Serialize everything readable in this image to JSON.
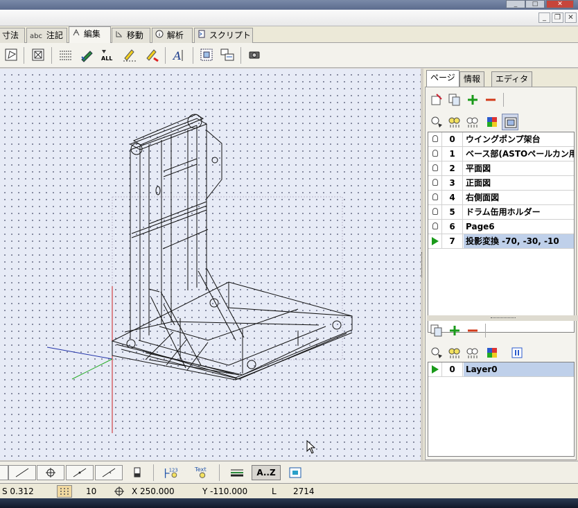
{
  "tabs": [
    {
      "label": "寸法",
      "icon": "dimension-icon",
      "active": false
    },
    {
      "label": "注記",
      "icon": "abc-text-icon",
      "icon_text": "abc",
      "active": false
    },
    {
      "label": "編集",
      "icon": "edit-icon",
      "active": true
    },
    {
      "label": "移動",
      "icon": "move-icon",
      "active": false
    },
    {
      "label": "解析",
      "icon": "info-icon",
      "active": false
    },
    {
      "label": "スクリプト",
      "icon": "script-icon",
      "active": false
    }
  ],
  "right_panel": {
    "tabs": [
      {
        "label": "ページ",
        "active": true
      },
      {
        "label": "情報",
        "active": false
      },
      {
        "label": "エディタ",
        "active": false
      }
    ],
    "pages": [
      {
        "index": "0",
        "name": "ウイングポンプ架台",
        "state": "visible"
      },
      {
        "index": "1",
        "name": "ベース部(ASTOペールカン用",
        "state": "visible"
      },
      {
        "index": "2",
        "name": "平面図",
        "state": "visible"
      },
      {
        "index": "3",
        "name": "正面図",
        "state": "visible"
      },
      {
        "index": "4",
        "name": "右側面図",
        "state": "visible"
      },
      {
        "index": "5",
        "name": "ドラム缶用ホルダー",
        "state": "visible"
      },
      {
        "index": "6",
        "name": "Page6",
        "state": "visible"
      },
      {
        "index": "7",
        "name": "投影変換 -70, -30, -10",
        "state": "current"
      }
    ],
    "layers": [
      {
        "index": "0",
        "name": "Layer0",
        "state": "current"
      }
    ]
  },
  "bottom_toolbar": {
    "text_tool_label": "Text",
    "numbering_tool_label": "123",
    "sort_button_label": "A..Z"
  },
  "status": {
    "scale": "S 0.312",
    "grid": "10",
    "x": "X 250.000",
    "y": "Y -110.000",
    "l_label": "L",
    "l_value": "2714"
  },
  "colors": {
    "accent": "#1a9a1a",
    "selection": "#bfd0ea",
    "canvas": "#e7ebf6",
    "axis_x": "#cc2222",
    "axis_y": "#22aa22",
    "axis_z": "#2233aa"
  }
}
